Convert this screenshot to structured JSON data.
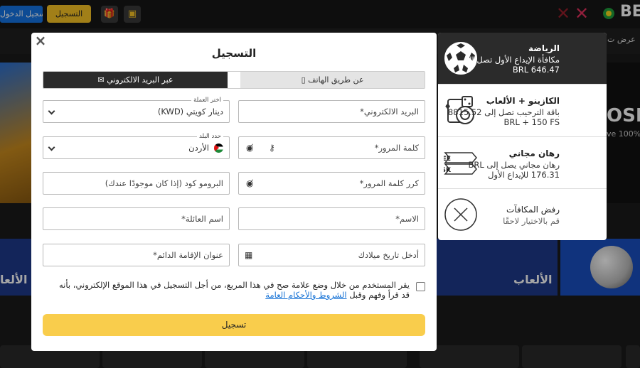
{
  "topbar": {
    "register_blue_label": "تسجيل الدخول",
    "register_yellow_label": "التسجيل",
    "brand": "BE"
  },
  "nav": {
    "show_label": "عرض ت"
  },
  "hero": {
    "line1": "OSIT",
    "line2": "ve 100%"
  },
  "strips": {
    "games_label": "الألعاب",
    "games_label_left": "الألعا"
  },
  "bonus": {
    "options": [
      {
        "title": "الرياضة",
        "desc": "مكافأة الإيداع الأول تصل إلى BRL 646.47",
        "icon": "soccer-ball-icon",
        "selected": true
      },
      {
        "title": "الكازينو + الألعاب",
        "desc": "باقة الترحيب تصل إلى 8815.52 BRL + 150 FS",
        "icon": "dice-cards-icon",
        "selected": false
      },
      {
        "title": "رهان مجاني",
        "desc": "رهان مجاني يصل إلى BRL 176.31 للإيداع الأول",
        "icon": "free-risk-icon",
        "icon_text_1": "FREE",
        "icon_text_2": "RISK",
        "selected": false
      },
      {
        "title": "رفض المكافآت",
        "desc": "قم بالاختيار لاحقًا",
        "icon": "decline-x-icon",
        "selected": false
      }
    ]
  },
  "modal": {
    "title": "التسجيل",
    "tabs": {
      "phone": "عن طريق الهاتف",
      "email": "عبر البريد الالكتروني",
      "active": "email"
    },
    "fields": {
      "email_placeholder": "البريد الالكتروني*",
      "currency_label": "اختر العملة",
      "currency_value": "دينار كويتي (KWD)",
      "password_placeholder": "كلمة المرور*",
      "country_label": "حدد البلد",
      "country_value": "الأردن",
      "confirm_password_placeholder": "كرر كلمة المرور*",
      "promo_placeholder": "البرومو كود (إذا كان موجودًا عندك)",
      "first_name_placeholder": "الاسم*",
      "last_name_placeholder": "اسم العائلة*",
      "birthdate_placeholder": "أدخل تاريخ ميلادك",
      "address_placeholder": "عنوان الإقامة الدائم*"
    },
    "agree_text": "يقر المستخدم من خلال وضع علامة صح في هذا المربع، من أجل التسجيل في هذا الموقع الإلكتروني، بأنه قد قرأ وفهم وقبل",
    "terms_link": "الشروط والأحكام العامة",
    "submit_label": "تسجيل"
  },
  "colors": {
    "accent_yellow": "#f9cd4c",
    "dark": "#2b2b2b",
    "link_blue": "#1572d6"
  }
}
